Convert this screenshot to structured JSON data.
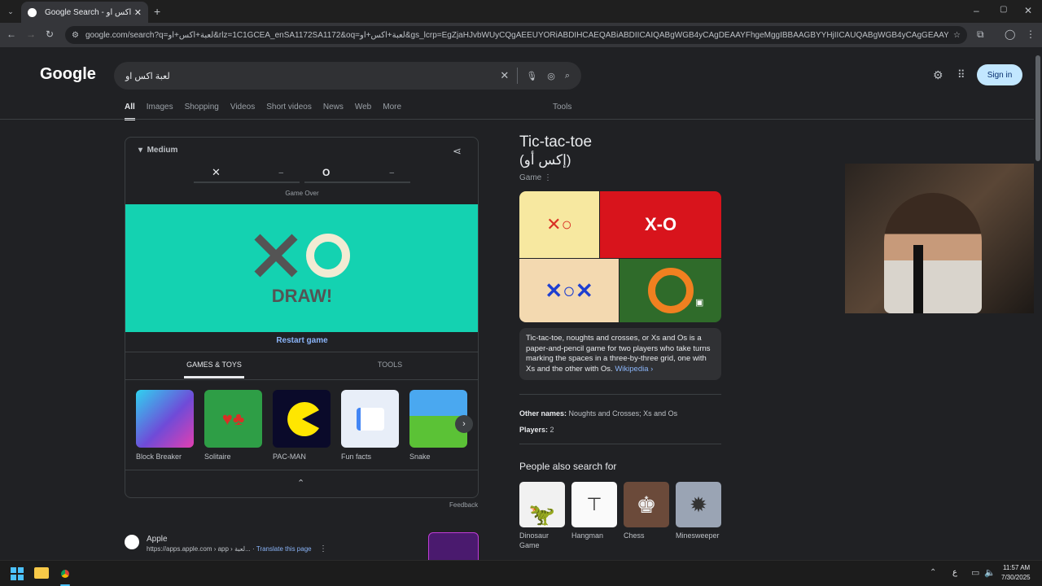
{
  "browser": {
    "tab_title": "Google Search - لعبة اكس او",
    "url": "google.com/search?q=لعبة+اكس+او&rlz=1C1GCEA_enSA1172SA1172&oq=لعبة+اكس+او&gs_lcrp=EgZjaHJvbWUyCQgAEEUYORiABDIHCAEQABiABDIICAIQABgWGB4yCAgDEAAYFhgeMggIBBAAGBYYHjIICAUQABgWGB4yCAgGEAAYFhgeMggIBxAAGBYYHjI..."
  },
  "google": {
    "logo": "Google",
    "query": "لعبة اكس او",
    "sign_in": "Sign in",
    "tabs": [
      "All",
      "Images",
      "Shopping",
      "Videos",
      "Short videos",
      "News",
      "Web",
      "More"
    ],
    "tools": "Tools"
  },
  "game_card": {
    "difficulty": "Medium",
    "player_x_score": "–",
    "player_o_score": "–",
    "status": "Game Over",
    "result": "DRAW!",
    "restart": "Restart game",
    "tabs": [
      "GAMES & TOYS",
      "TOOLS"
    ],
    "games": [
      {
        "name": "Block Breaker",
        "color": "#4a3fbf"
      },
      {
        "name": "Solitaire",
        "color": "#2e9e46"
      },
      {
        "name": "PAC-MAN",
        "color": "#0a0a2a"
      },
      {
        "name": "Fun facts",
        "color": "#e8eef8"
      },
      {
        "name": "Snake",
        "color": "#4aa8f0"
      }
    ],
    "feedback": "Feedback"
  },
  "result": {
    "site": "Apple",
    "url": "https://apps.apple.com › app › لعبة...",
    "translate": "Translate this page"
  },
  "knowledge_panel": {
    "title": "Tic-tac-toe",
    "subtitle": "(إكس أو)",
    "type": "Game",
    "description": "Tic-tac-toe, noughts and crosses, or Xs and Os is a paper-and-pencil game for two players who take turns marking the spaces in a three-by-three grid, one with Xs and the other with Os.",
    "wiki": "Wikipedia ›",
    "other_names_label": "Other names:",
    "other_names": "Noughts and Crosses; Xs and Os",
    "players_label": "Players:",
    "players": "2",
    "pas_title": "People also search for",
    "pas": [
      {
        "name": "Dinosaur Game"
      },
      {
        "name": "Hangman"
      },
      {
        "name": "Chess"
      },
      {
        "name": "Minesweeper"
      }
    ]
  },
  "taskbar": {
    "time": "11:57 AM",
    "date": "7/30/2025",
    "lang": "ع"
  },
  "colors": {
    "board": "#14d2b1",
    "accent": "#8ab4f8",
    "signin_bg": "#c2e7ff"
  }
}
